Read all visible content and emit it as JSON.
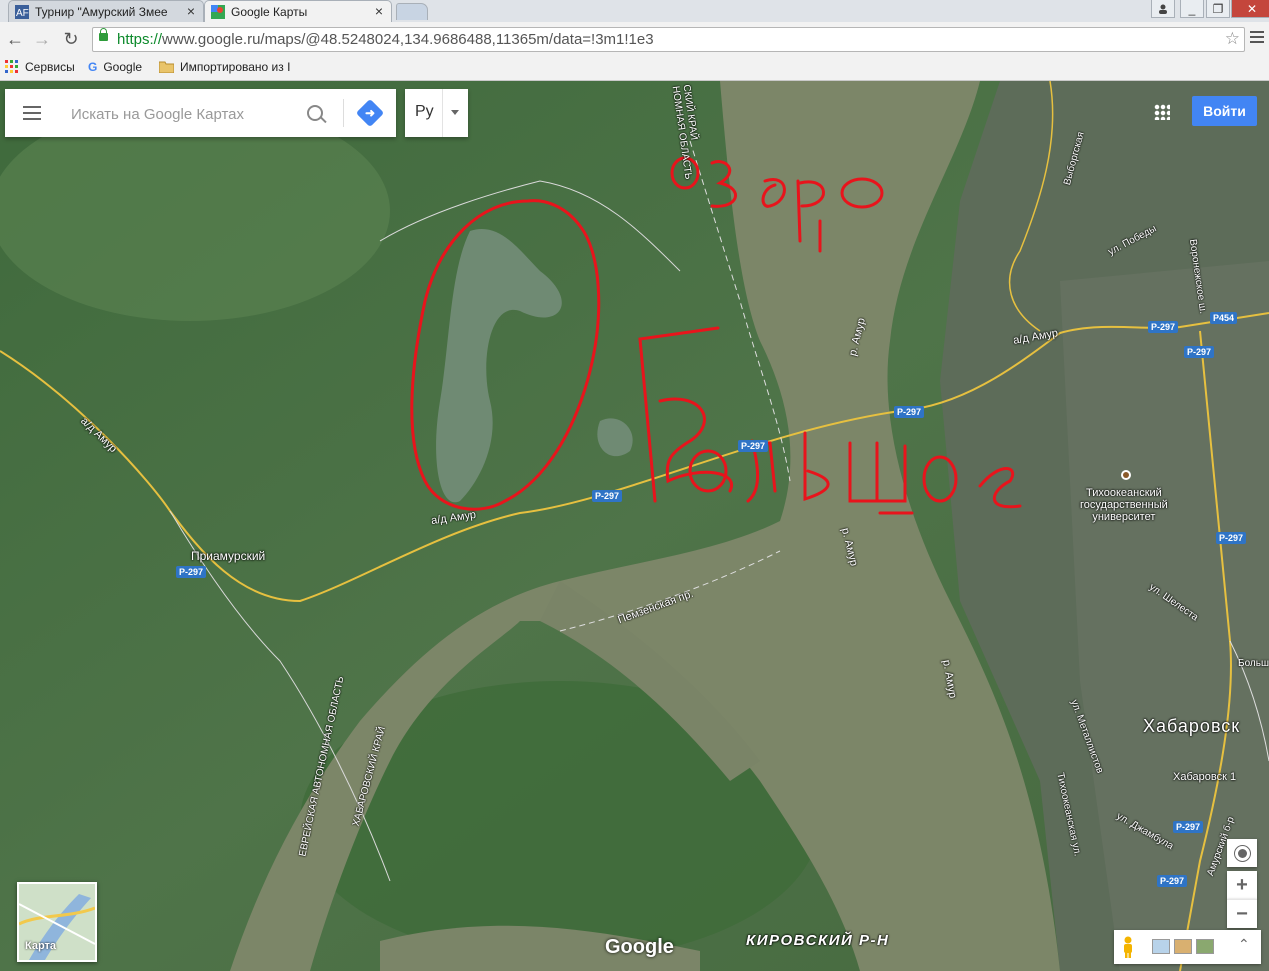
{
  "browser": {
    "tabs": [
      {
        "title": "Турнир \"Амурский Змее",
        "active": false
      },
      {
        "title": "Google Карты",
        "active": true
      }
    ],
    "url_proto": "https://",
    "url_rest": "www.google.ru/maps/@48.5248024,134.9686488,11365m/data=!3m1!1e3",
    "bookmarks": [
      "Сервисы",
      "Google",
      "Импортировано из I"
    ]
  },
  "maps": {
    "search_placeholder": "Искать на Google Картах",
    "language": "Ру",
    "signin_label": "Войти",
    "map_toggle_label": "Карта",
    "logo": "Google",
    "district": "КИРОВСКИЙ Р-Н"
  },
  "map_labels": {
    "ad_amur_1": "а/д Амур",
    "ad_amur_2": "а/д Амур",
    "ad_amur_3": "а/д Амур",
    "priamursky": "Приамурский",
    "r_amur_1": "р. Амур",
    "r_amur_2": "р. Амур",
    "r_amur_3": "р. Амур",
    "pemzenskaya": "Пемзенская пр.",
    "khabarovsk": "Хабаровск",
    "khabarovsk1": "Хабаровск 1",
    "university": "Тихоокеанский\nгосударственный\nуниверситет",
    "ul_pobedy": "ул. Победы",
    "ul_shelesta": "ул. Шелеста",
    "ul_metallistov": "ул. Металлистов",
    "ul_dzhambula": "ул. Джамбула",
    "tikhookeanskaya": "Тихоокеанская ул.",
    "voronezhskoe": "Воронежское ш.",
    "amurskiy_bul": "Амурский б-р",
    "ul_vyborgskaya": "Выборгская",
    "bolsh": "Больш",
    "border_top": "СКИЙ КРАЙ\nНОМНАЯ ОБЛАСТЬ",
    "border_vertical_1": "ЕВРЕЙСКАЯ АВТОНОМНАЯ ОБЛАСТЬ",
    "border_vertical_2": "ХАБАРОВСКИЙ КРАЙ"
  },
  "routes": [
    "Р-297",
    "Р-297",
    "Р-297",
    "Р-297",
    "Р-297",
    "Р-297",
    "Р-297",
    "Р-297",
    "Р-297",
    "Р454"
  ],
  "annotation": {
    "color": "#e8141c",
    "word_1": "Озеро",
    "word_2": "Большое"
  },
  "colors": {
    "terrain": "#4c6e47",
    "river": "#7d8a6b",
    "road": "#e6c040",
    "accent": "#4285f4"
  }
}
